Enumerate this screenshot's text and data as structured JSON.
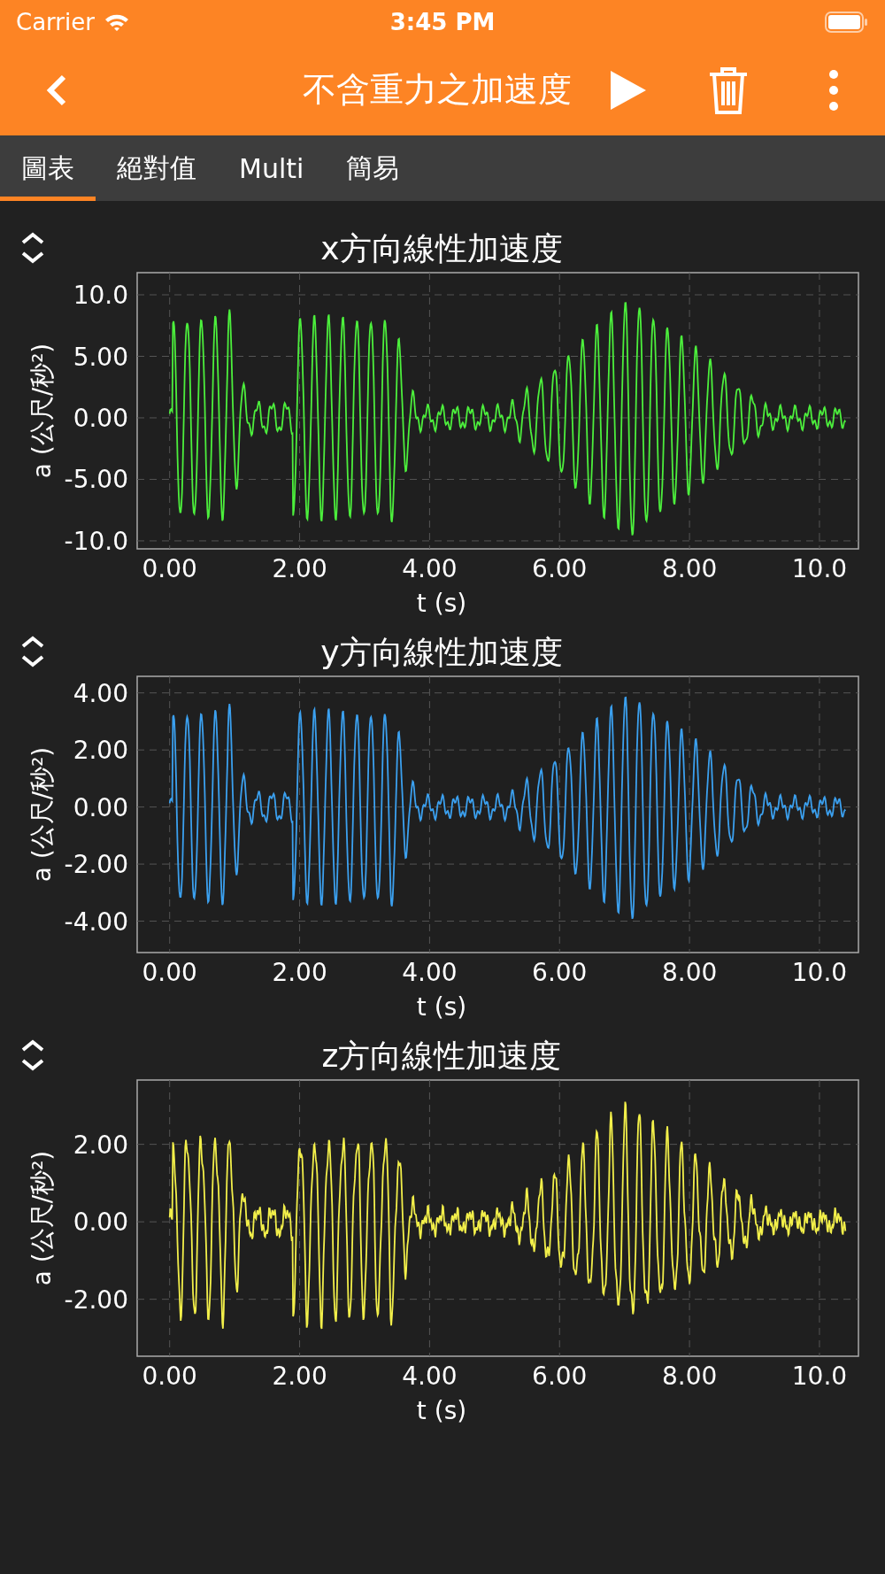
{
  "status_bar": {
    "carrier": "Carrier",
    "time": "3:45 PM"
  },
  "app_bar": {
    "title": "不含重力之加速度"
  },
  "tabs": [
    {
      "label": "圖表",
      "selected": true
    },
    {
      "label": "絕對值",
      "selected": false
    },
    {
      "label": "Multi",
      "selected": false
    },
    {
      "label": "簡易",
      "selected": false
    }
  ],
  "charts": [
    {
      "title": "x方向線性加速度",
      "color": "#4cef3c",
      "ylabel": "a (公尺/秒²)",
      "xlabel": "t (s)",
      "yticks": [
        "10.0",
        "5.00",
        "0.00",
        "-5.00",
        "-10.0"
      ],
      "xticks": [
        "0.00",
        "2.00",
        "4.00",
        "6.00",
        "8.00",
        "10.0"
      ]
    },
    {
      "title": "y方向線性加速度",
      "color": "#3ba0ef",
      "ylabel": "a (公尺/秒²)",
      "xlabel": "t (s)",
      "yticks": [
        "4.00",
        "2.00",
        "0.00",
        "-2.00",
        "-4.00"
      ],
      "xticks": [
        "0.00",
        "2.00",
        "4.00",
        "6.00",
        "8.00",
        "10.0"
      ]
    },
    {
      "title": "z方向線性加速度",
      "color": "#f2ef4a",
      "ylabel": "a (公尺/秒²)",
      "xlabel": "t (s)",
      "yticks": [
        "2.00",
        "0.00",
        "-2.00"
      ],
      "xticks": [
        "0.00",
        "2.00",
        "4.00",
        "6.00",
        "8.00",
        "10.0"
      ]
    }
  ]
}
